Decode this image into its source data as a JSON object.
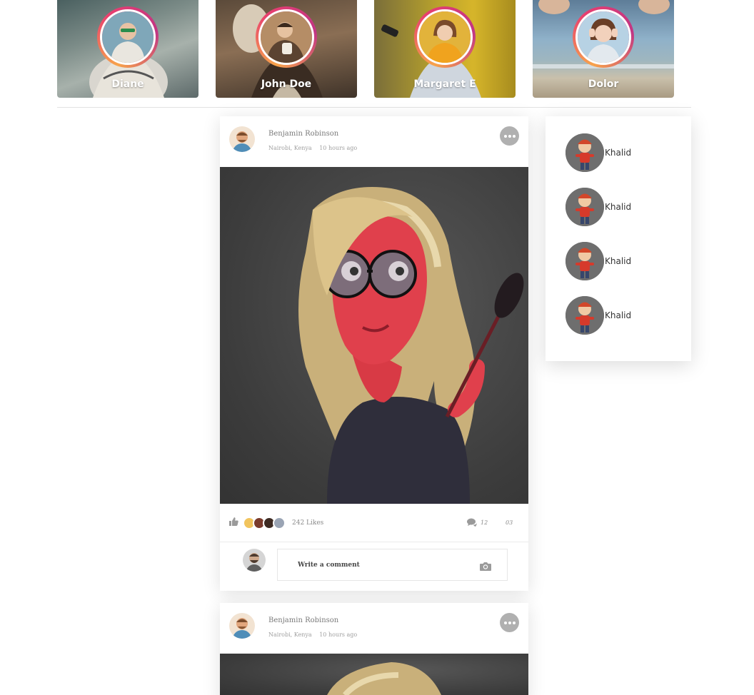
{
  "stories": [
    {
      "name": "Diane"
    },
    {
      "name": "John Doe"
    },
    {
      "name": "Margaret E"
    },
    {
      "name": "Dolor"
    }
  ],
  "posts": [
    {
      "author": "Benjamin Robinson",
      "location": "Nairobi, Kenya",
      "time": "10 hours ago",
      "likes_label": "242 Likes",
      "comments_count": "12",
      "shares_count": "03",
      "comment_placeholder": "Write a comment"
    },
    {
      "author": "Benjamin Robinson",
      "location": "Nairobi, Kenya",
      "time": "10 hours ago"
    }
  ],
  "suggestions": [
    {
      "name": "Khalid"
    },
    {
      "name": "Khalid"
    },
    {
      "name": "Khalid"
    },
    {
      "name": "Khalid"
    }
  ],
  "icons": {
    "more": "more-icon",
    "like": "thumbs-up-icon",
    "comment": "comment-icon",
    "camera": "camera-icon"
  },
  "colors": {
    "story_ring_start": "#f7a34b",
    "story_ring_end": "#c13584",
    "more_button": "#b0b0b0"
  }
}
